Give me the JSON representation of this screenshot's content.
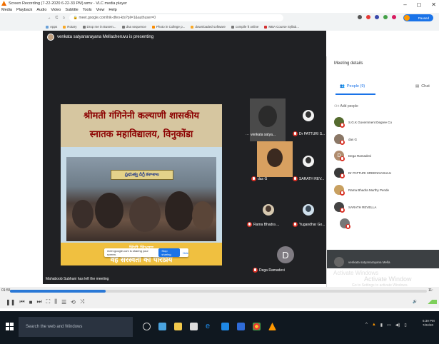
{
  "window": {
    "title": "Screen Recording (7-22-2020 6-22-33 PM).wmv - VLC media player",
    "controls": [
      "–",
      "◻",
      "✕"
    ]
  },
  "menu": [
    "Media",
    "Playback",
    "Audio",
    "Video",
    "Subtitle",
    "Tools",
    "View",
    "Help"
  ],
  "browser": {
    "url": "meet.google.com/hik-dfeo-kts?pli=1&authuser=0",
    "bookmarks": [
      "Apps",
      "Rotary",
      "Drop me in Busem...",
      "dna sequence",
      "Photo in College p...",
      "downloaded software",
      "compile ft online",
      "MBA Course Syllab..."
    ],
    "profile_label": "Paused"
  },
  "meet": {
    "presenter_text": "venkata satyanarayana Mellacheruvu is presenting",
    "slide": {
      "title_line1": "श्रीमती गंगिनेनी कल्याणी शासकीय",
      "title_line2": "स्नातक महाविद्यालय, विनुकोंडा",
      "banner": "ప్రభుత్వ డిగ్రీ కళాశాల",
      "footer_line1": "हिंदी विभाग",
      "footer_line2": "वह सरस्वती का पारप्रिय"
    },
    "share_popup": {
      "text": "meet.google.com is sharing your screen.",
      "stop": "Stop sharing",
      "hide": "Hide"
    },
    "tiles": [
      {
        "name": "venkata satya..."
      },
      {
        "name": "Dr PATTURI S..."
      },
      {
        "name": "das G"
      },
      {
        "name": "SARATH REV..."
      },
      {
        "name": "Rama Bhadra ..."
      },
      {
        "name": "Yugandhar Go..."
      }
    ],
    "big_tile": {
      "letter": "D",
      "name": "Dega Ramadevi"
    },
    "toast": "Mahaboob Subhani has left the meeting"
  },
  "panel": {
    "title": "Meeting details",
    "tab_people": "People (9)",
    "tab_chat": "Chat",
    "add_people": "Add people",
    "people": [
      "S.G.K Government Degree Co",
      "das G",
      "Dega Ramadevi",
      "Dr PATTURI SREENIVASULU",
      "Rama Bhadra Murthy Pende",
      "SARATH REVELLA",
      "venkata satyanarayana Mella",
      "venkata satyanarayana Mella"
    ],
    "activate1": "Activate Windows",
    "activate2": "Activate Window",
    "activate3": "Go to Settings to activate Windows."
  },
  "player": {
    "time_elapsed": "01:55",
    "time_total": "11:",
    "progress": 0.23,
    "volume": "100%"
  },
  "taskbar": {
    "search_placeholder": "Search the web and Windows",
    "clock_time": "6:39 PM",
    "clock_date": "7/22/20"
  },
  "colors": {
    "accent": "#1a73e8",
    "meet_bg": "#202124",
    "mic_off": "#d93025",
    "vlc_seek": "#2a78d6",
    "taskbar": "#101820"
  }
}
